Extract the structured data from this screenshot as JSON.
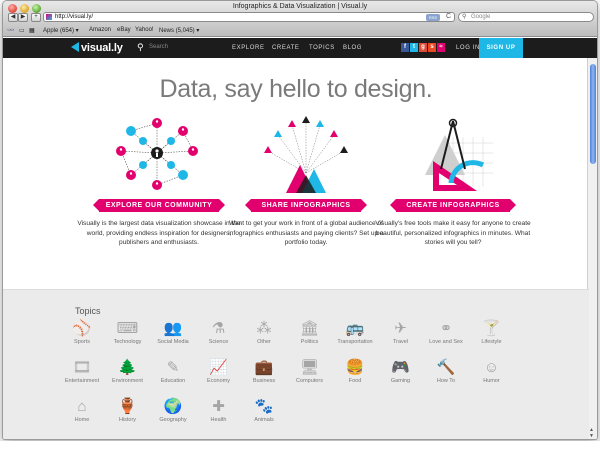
{
  "browser": {
    "window_title": "Infographics & Data Visualization | Visual.ly",
    "nav": {
      "back": "◀",
      "forward": "▶",
      "add": "+"
    },
    "url": "http://visual.ly/",
    "rss": "RSS",
    "reload": "C",
    "search_placeholder": "Google",
    "bookmarks": [
      "Apple (654) ▾",
      "Amazon",
      "eBay",
      "Yahoo!",
      "News (5,045) ▾"
    ]
  },
  "site": {
    "logo": "visual.ly",
    "search_placeholder": "Search",
    "nav": [
      "EXPLORE",
      "CREATE",
      "TOPICS",
      "BLOG"
    ],
    "social_icons": [
      "facebook-icon",
      "twitter-icon",
      "google-plus-icon",
      "stumbleupon-icon",
      "rss-icon"
    ],
    "login": "LOG IN",
    "signup": "SIGN UP",
    "accent_color": "#1fb8e6",
    "brand_pink": "#e2006e"
  },
  "hero": {
    "title": "Data, say hello to design."
  },
  "features": [
    {
      "button": "EXPLORE OUR COMMUNITY",
      "text": "Visually is the largest data visualization showcase in the world, providing endless inspiration for designers, publishers and enthusiasts."
    },
    {
      "button": "SHARE INFOGRAPHICS",
      "text": "Want to get your work in front of a global audience of infographics enthusiasts and paying clients? Set up a portfolio today."
    },
    {
      "button": "CREATE INFOGRAPHICS",
      "text": "Visually's free tools make it easy for anyone to create beautiful, personalized infographics in minutes. What stories will you tell?"
    }
  ],
  "topics": {
    "title": "Topics",
    "items": [
      {
        "label": "Sports",
        "icon": "⚾"
      },
      {
        "label": "Technology",
        "icon": "⌨"
      },
      {
        "label": "Social Media",
        "icon": "👥"
      },
      {
        "label": "Science",
        "icon": "⚗"
      },
      {
        "label": "Other",
        "icon": "⁂"
      },
      {
        "label": "Politics",
        "icon": "🏛"
      },
      {
        "label": "Transportation",
        "icon": "🚌"
      },
      {
        "label": "Travel",
        "icon": "✈"
      },
      {
        "label": "Love and Sex",
        "icon": "⚭"
      },
      {
        "label": "Lifestyle",
        "icon": "🍸"
      },
      {
        "label": "Entertainment",
        "icon": "🎞"
      },
      {
        "label": "Environment",
        "icon": "🌲"
      },
      {
        "label": "Education",
        "icon": "✎"
      },
      {
        "label": "Economy",
        "icon": "📈"
      },
      {
        "label": "Business",
        "icon": "💼"
      },
      {
        "label": "Computers",
        "icon": "🖥"
      },
      {
        "label": "Food",
        "icon": "🍔"
      },
      {
        "label": "Gaming",
        "icon": "🎮"
      },
      {
        "label": "How To",
        "icon": "🔨"
      },
      {
        "label": "Humor",
        "icon": "☺"
      },
      {
        "label": "Home",
        "icon": "⌂"
      },
      {
        "label": "History",
        "icon": "🏺"
      },
      {
        "label": "Geography",
        "icon": "🌍"
      },
      {
        "label": "Health",
        "icon": "✚"
      },
      {
        "label": "Animals",
        "icon": "🐾"
      }
    ]
  }
}
